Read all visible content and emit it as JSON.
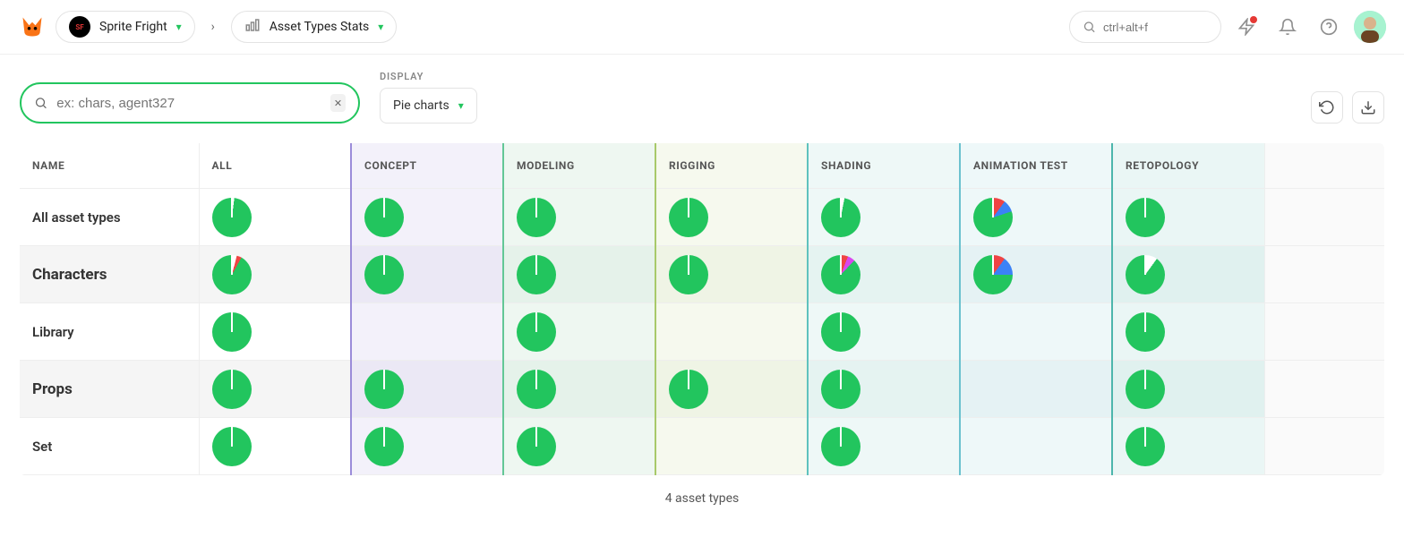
{
  "header": {
    "project": "Sprite Fright",
    "page": "Asset Types Stats",
    "search_placeholder": "ctrl+alt+f"
  },
  "controls": {
    "filter_placeholder": "ex: chars, agent327",
    "display_label": "DISPLAY",
    "display_value": "Pie charts"
  },
  "columns": [
    "NAME",
    "ALL",
    "CONCEPT",
    "MODELING",
    "RIGGING",
    "SHADING",
    "ANIMATION TEST",
    "RETOPOLOGY"
  ],
  "rows": [
    {
      "name": "All asset types",
      "bold": false
    },
    {
      "name": "Characters",
      "bold": true
    },
    {
      "name": "Library",
      "bold": true
    },
    {
      "name": "Props",
      "bold": true
    },
    {
      "name": "Set",
      "bold": true
    }
  ],
  "footer": "4 asset types",
  "chart_data": {
    "type": "pie",
    "colors": {
      "done": "#22c55e",
      "wip": "#3b82f6",
      "todo": "#ef4444",
      "review": "#d946ef",
      "empty": "#ffffff"
    },
    "legend_note": "per-cell task status distribution; null = no pie rendered",
    "cells": [
      [
        {
          "done": 98,
          "wip": 0,
          "todo": 0,
          "review": 0,
          "empty": 2
        },
        {
          "done": 100
        },
        {
          "done": 100
        },
        {
          "done": 100
        },
        {
          "done": 97,
          "empty": 3
        },
        {
          "done": 80,
          "wip": 10,
          "todo": 10
        },
        {
          "done": 100
        }
      ],
      [
        {
          "done": 92,
          "todo": 4,
          "empty": 4
        },
        {
          "done": 100
        },
        {
          "done": 100
        },
        {
          "done": 100
        },
        {
          "done": 88,
          "todo": 6,
          "review": 6
        },
        {
          "done": 75,
          "wip": 15,
          "todo": 10
        },
        {
          "done": 90,
          "empty": 10
        }
      ],
      [
        {
          "done": 100
        },
        null,
        {
          "done": 100
        },
        null,
        {
          "done": 100
        },
        null,
        {
          "done": 100
        }
      ],
      [
        {
          "done": 100
        },
        {
          "done": 100
        },
        {
          "done": 100
        },
        {
          "done": 100
        },
        {
          "done": 100
        },
        null,
        {
          "done": 100
        }
      ],
      [
        {
          "done": 100
        },
        {
          "done": 100
        },
        {
          "done": 100
        },
        null,
        {
          "done": 100
        },
        null,
        {
          "done": 100
        }
      ]
    ]
  }
}
